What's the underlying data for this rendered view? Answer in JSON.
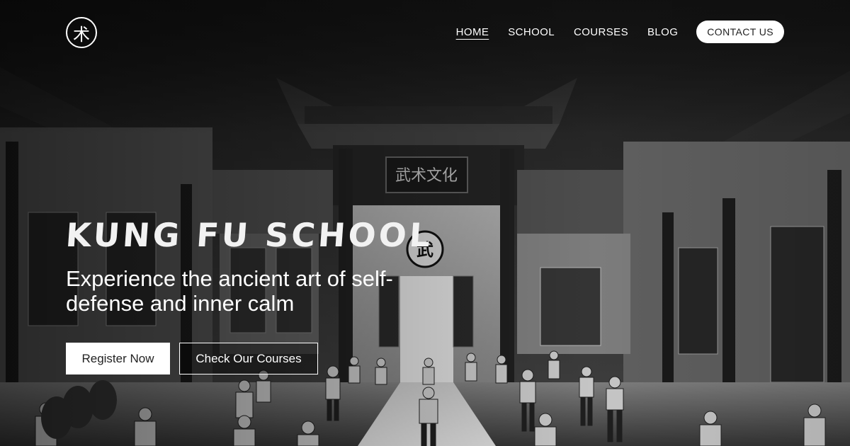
{
  "logo": {
    "glyph": "术",
    "icon": "kung-fu-logo-icon"
  },
  "nav": {
    "items": [
      {
        "label": "HOME",
        "active": true
      },
      {
        "label": "SCHOOL",
        "active": false
      },
      {
        "label": "COURSES",
        "active": false
      },
      {
        "label": "BLOG",
        "active": false
      }
    ],
    "contact_label": "CONTACT US"
  },
  "hero": {
    "title": "KUNG FU SCHOOL",
    "subtitle": "Experience the ancient art of self-defense and inner calm",
    "primary_button": "Register Now",
    "secondary_button": "Check Our Courses"
  },
  "background": {
    "gate_sign": "武术文化",
    "emblem_glyph": "武"
  },
  "colors": {
    "header_bg": "#141414",
    "text": "#ffffff",
    "button_bg": "#ffffff",
    "button_text": "#222222"
  }
}
